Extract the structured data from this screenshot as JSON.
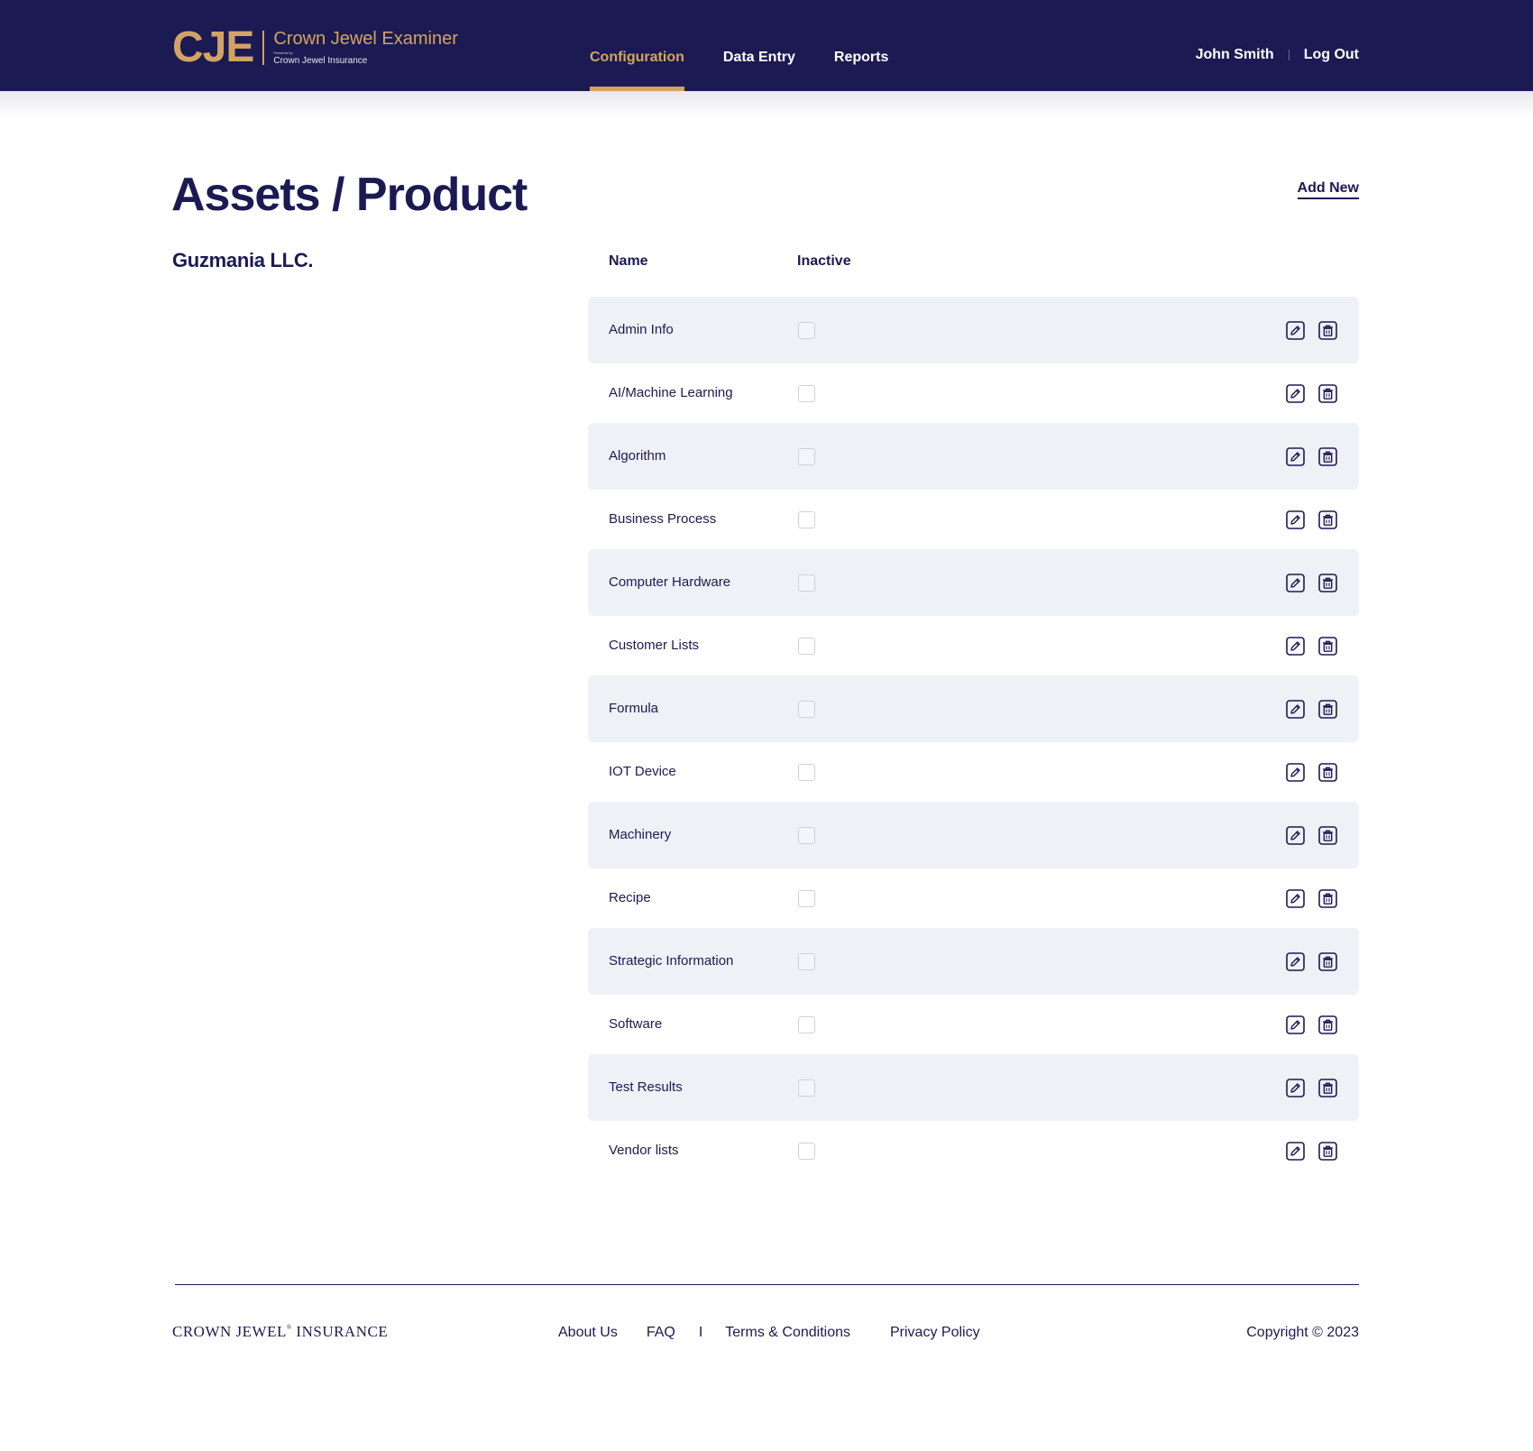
{
  "header": {
    "logo_mark": "CJE",
    "logo_title": "Crown Jewel Examiner",
    "logo_powered": "Powered by",
    "logo_sub": "Crown Jewel Insurance",
    "nav": [
      {
        "label": "Configuration",
        "active": true
      },
      {
        "label": "Data Entry",
        "active": false
      },
      {
        "label": "Reports",
        "active": false
      }
    ],
    "user_name": "John Smith",
    "logout_label": "Log Out"
  },
  "main": {
    "title": "Assets / Product",
    "add_new_label": "Add New",
    "company": "Guzmania LLC.",
    "columns": {
      "name": "Name",
      "inactive": "Inactive"
    },
    "rows": [
      {
        "name": "Admin Info",
        "inactive": false
      },
      {
        "name": "AI/Machine Learning",
        "inactive": false
      },
      {
        "name": "Algorithm",
        "inactive": false
      },
      {
        "name": "Business Process",
        "inactive": false
      },
      {
        "name": "Computer Hardware",
        "inactive": false
      },
      {
        "name": "Customer Lists",
        "inactive": false
      },
      {
        "name": "Formula",
        "inactive": false
      },
      {
        "name": "IOT Device",
        "inactive": false
      },
      {
        "name": "Machinery",
        "inactive": false
      },
      {
        "name": "Recipe",
        "inactive": false
      },
      {
        "name": "Strategic Information",
        "inactive": false
      },
      {
        "name": "Software",
        "inactive": false
      },
      {
        "name": "Test Results",
        "inactive": false
      },
      {
        "name": "Vendor lists",
        "inactive": false
      }
    ],
    "row_actions": {
      "edit_icon": "edit-icon",
      "delete_icon": "trash-icon"
    }
  },
  "footer": {
    "brand": "CROWN JEWEL",
    "brand_mark": "®",
    "brand_suffix": " INSURANCE",
    "links": {
      "about": "About Us",
      "faq": "FAQ",
      "separator": "I",
      "terms": "Terms & Conditions",
      "privacy": "Privacy Policy"
    },
    "copyright": "Copyright © 2023"
  },
  "colors": {
    "navy": "#1c1a52",
    "gold": "#d2a464",
    "row_alt": "#eef1f6"
  }
}
